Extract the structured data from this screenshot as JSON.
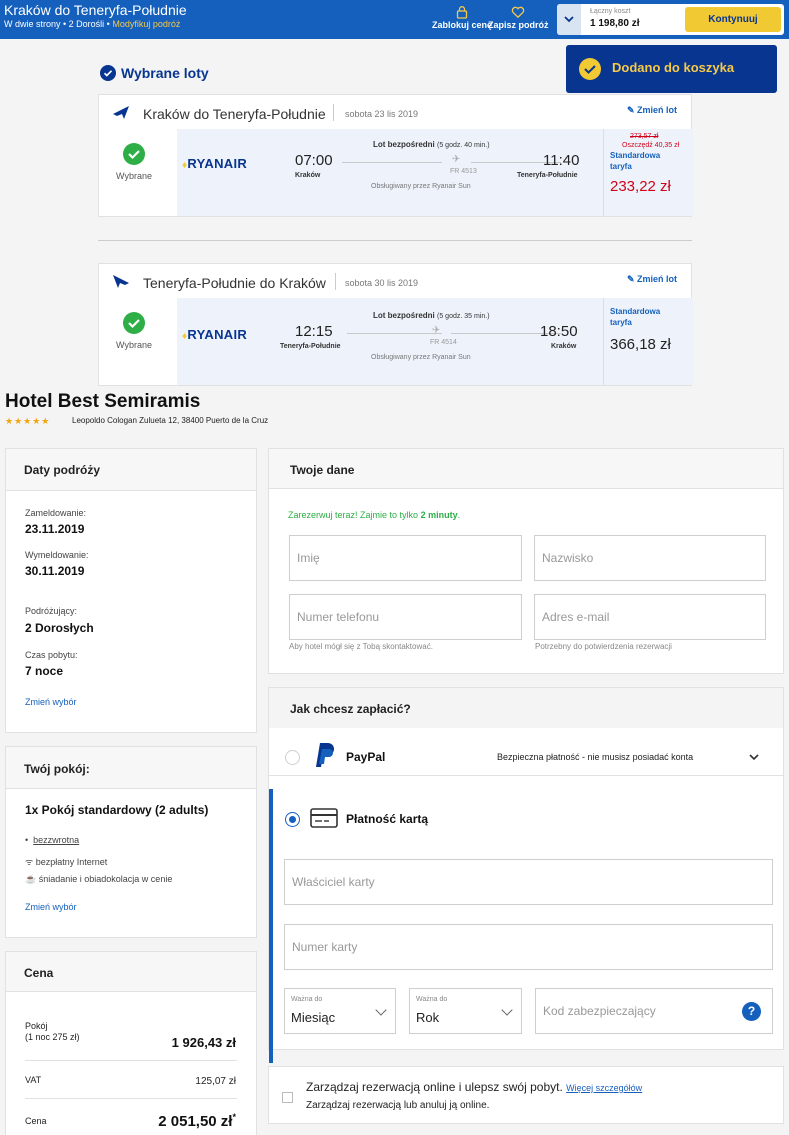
{
  "topbar": {
    "title": "Kraków do Teneryfa-Południe",
    "subtitle": "W dwie strony • 2 Dorośli •",
    "modify": "Modyfikuj podróż",
    "lock_price": "Zablokuj cenę",
    "save_trip": "Zapisz podróż",
    "total_label": "Łączny koszt",
    "total_value": "1 198,80 zł",
    "continue": "Kontynuuj"
  },
  "toast": "Dodano do koszyka",
  "selected_heading": "Wybrane loty",
  "flights": [
    {
      "route": "Kraków do Teneryfa-Południe",
      "date": "sobota 23 lis 2019",
      "change": "Zmień lot",
      "chosen": "Wybrane",
      "airline": "RYANAIR",
      "dep_time": "07:00",
      "dep_city": "Kraków",
      "direct": "Lot bezpośredni",
      "duration": "(5 godz. 40 min.)",
      "flight_no": "FR 4513",
      "operated": "Obsługiwany przez Ryanair Sun",
      "arr_time": "11:40",
      "arr_city": "Teneryfa-Południe",
      "old_price": "273,57 zł",
      "saving": "Oszczędź 40,35 zł",
      "tariff_1": "Standardowa",
      "tariff_2": "taryfa",
      "price": "233,22 zł"
    },
    {
      "route": "Teneryfa-Południe do Kraków",
      "date": "sobota 30 lis 2019",
      "change": "Zmień lot",
      "chosen": "Wybrane",
      "airline": "RYANAIR",
      "dep_time": "12:15",
      "dep_city": "Teneryfa-Południe",
      "direct": "Lot bezpośredni",
      "duration": "(5 godz. 35 min.)",
      "flight_no": "FR 4514",
      "operated": "Obsługiwany przez Ryanair Sun",
      "arr_time": "18:50",
      "arr_city": "Kraków",
      "tariff_1": "Standardowa",
      "tariff_2": "taryfa",
      "price": "366,18 zł"
    }
  ],
  "hotel": {
    "name": "Hotel Best Semiramis",
    "stars": "★★★★★",
    "address": "Leopoldo Cologan Zulueta 12, 38400 Puerto de la Cruz"
  },
  "dates": {
    "title": "Daty podróży",
    "checkin_label": "Zameldowanie:",
    "checkin": "23.11.2019",
    "checkout_label": "Wymeldowanie:",
    "checkout": "30.11.2019",
    "travelers_label": "Podróżujący:",
    "travelers": "2 Dorosłych",
    "stay_label": "Czas pobytu:",
    "stay": "7 noce",
    "change": "Zmień wybór"
  },
  "room": {
    "title": "Twój pokój:",
    "name": "1x Pokój standardowy (2 adults)",
    "f1": "bezzwrotna",
    "f2": "bezpłatny Internet",
    "f3": "śniadanie i obiadokolacja w cenie",
    "change": "Zmień wybór"
  },
  "price": {
    "title": "Cena",
    "rooms_label": "Pokój",
    "rooms_sub": "(1 noc 275 zł)",
    "rooms_value": "1 926,43 zł",
    "vat_label": "VAT",
    "vat_value": "125,07 zł",
    "total_label": "Cena",
    "total_value": "2 051,50 zł",
    "asterisk": "*"
  },
  "details": {
    "title": "Twoje dane",
    "promo_a": "Zarezerwuj teraz! Zajmie to tylko",
    "promo_b": "2 minuty",
    "promo_c": ".",
    "first_name": "Imię",
    "last_name": "Nazwisko",
    "phone": "Numer telefonu",
    "email": "Adres e-mail",
    "phone_hint": "Aby hotel mógł się z Tobą skontaktować.",
    "email_hint": "Potrzebny do potwierdzenia rezerwacji"
  },
  "payment": {
    "title": "Jak chcesz zapłacić?",
    "paypal": "PayPal",
    "paypal_note": "Bezpieczna płatność - nie musisz posiadać konta",
    "card": "Płatność kartą",
    "card_holder": "Właściciel karty",
    "card_number": "Numer karty",
    "valid_label": "Ważna do",
    "month": "Miesiąc",
    "year": "Rok",
    "cvv": "Kod zabezpieczający"
  },
  "manage": {
    "main": "Zarządzaj rezerwacją online i ulepsz swój pobyt.",
    "more": "Więcej szczegółów",
    "sub": "Zarządzaj rezerwacją lub anuluj ją online."
  },
  "colors": {
    "brand_blue": "#073590",
    "accent_blue": "#1560bd",
    "yellow": "#f1c933",
    "price_red": "#d0021b",
    "green": "#2eae46"
  }
}
